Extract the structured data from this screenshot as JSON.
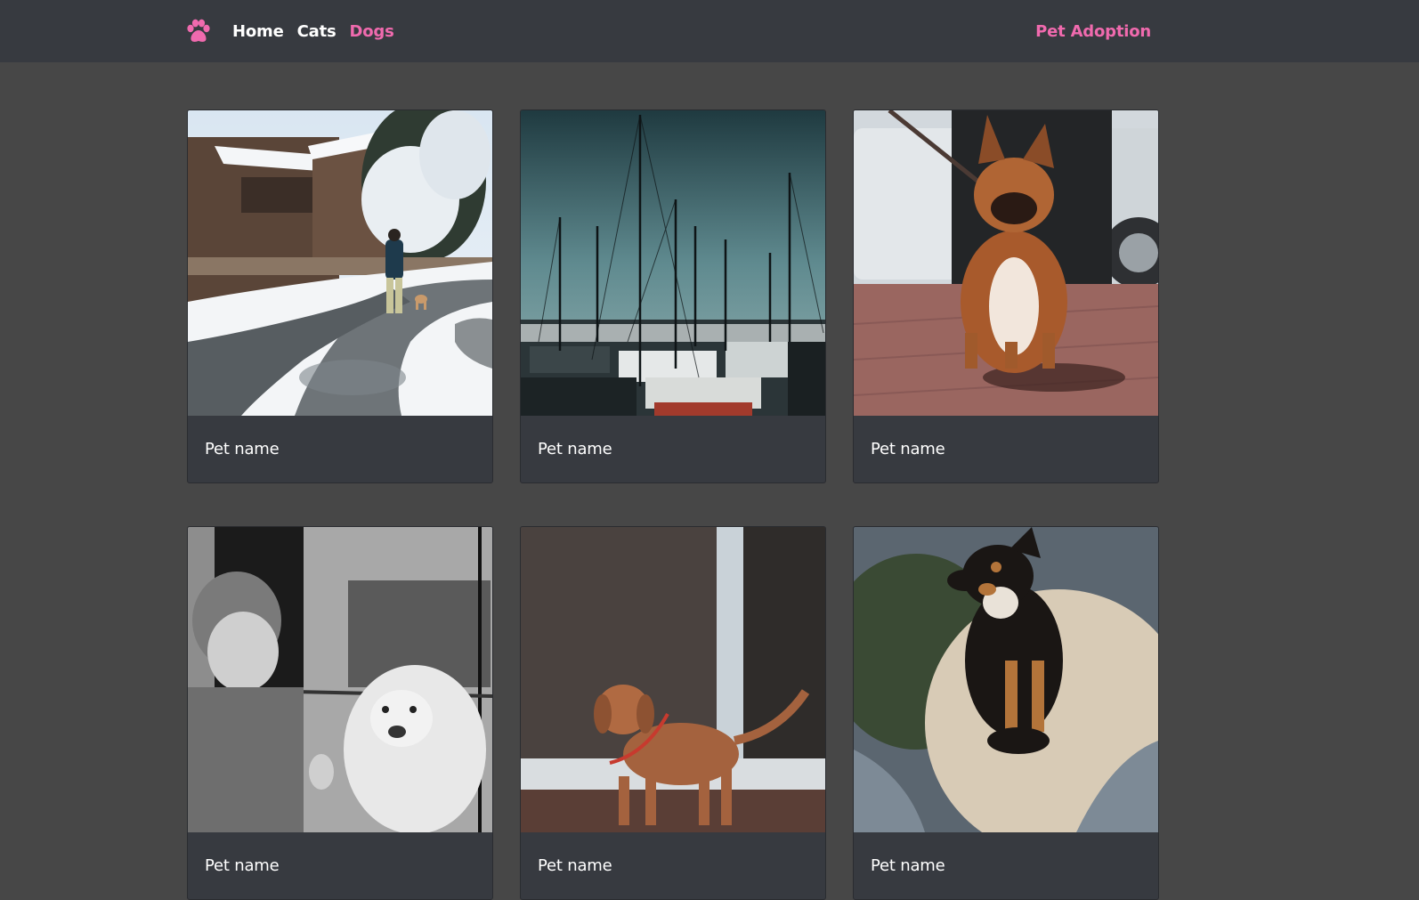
{
  "nav": {
    "brand_icon": "paw-icon",
    "brand_color": "#f06aae",
    "links": [
      {
        "label": "Home",
        "active": false
      },
      {
        "label": "Cats",
        "active": false
      },
      {
        "label": "Dogs",
        "active": true
      }
    ],
    "site_title": "Pet Adoption"
  },
  "cards": [
    {
      "name": "Pet name",
      "image": "snowy-village-walk-photo"
    },
    {
      "name": "Pet name",
      "image": "harbor-sailboats-photo"
    },
    {
      "name": "Pet name",
      "image": "french-bulldog-photo"
    },
    {
      "name": "Pet name",
      "image": "child-and-golden-retriever-photo"
    },
    {
      "name": "Pet name",
      "image": "brown-puppy-photo"
    },
    {
      "name": "Pet name",
      "image": "black-tan-dog-on-cushion-photo"
    }
  ],
  "colors": {
    "navbar_bg": "#373a40",
    "page_bg": "#474747",
    "accent": "#f06aae"
  }
}
